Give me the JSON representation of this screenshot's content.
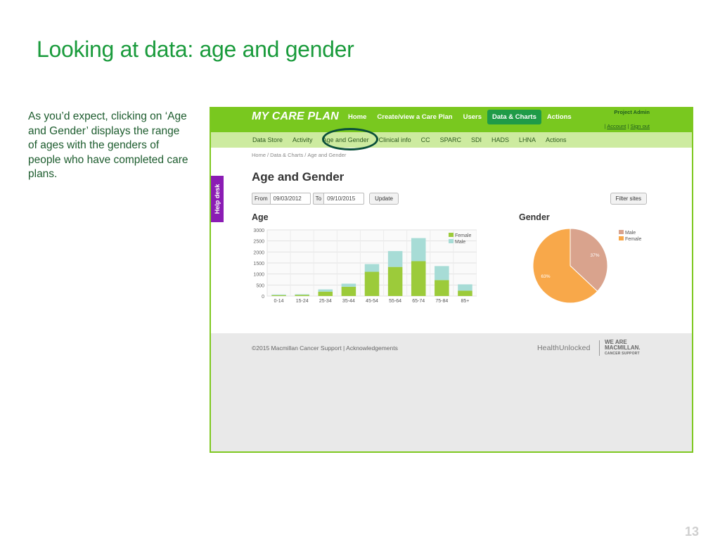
{
  "slide": {
    "title": "Looking at data: age and gender",
    "intro": "As you’d expect, clicking on ‘Age and Gender’ displays the range of ages with the genders of people who have completed care plans.",
    "page_number": "13"
  },
  "app": {
    "logo": "MY CARE PLAN",
    "nav": [
      "Home",
      "Create/view a Care Plan",
      "Users",
      "Data & Charts",
      "Actions"
    ],
    "nav_active": "Data & Charts",
    "user": {
      "name": "Project Admin",
      "account": "Account",
      "sign_out": "Sign out"
    },
    "subnav": [
      "Data Store",
      "Activity",
      "Age and Gender",
      "Clinical info",
      "CC",
      "SPARC",
      "SDI",
      "HADS",
      "LHNA",
      "Actions"
    ],
    "breadcrumb": [
      "Home",
      "Data & Charts",
      "Age and Gender"
    ],
    "help_desk": "Help desk",
    "heading": "Age and Gender",
    "filters": {
      "from_label": "From",
      "from_value": "09/03/2012",
      "to_label": "To",
      "to_value": "09/10/2015",
      "update_label": "Update",
      "filter_sites_label": "Filter sites"
    },
    "footer": {
      "copyright": "©2015 Macmillan Cancer Support | Acknowledgements",
      "healthunlocked": "HealthUnlocked",
      "macmillan_line1": "WE ARE",
      "macmillan_line2": "MACMILLAN.",
      "macmillan_line3": "CANCER SUPPORT"
    }
  },
  "colors": {
    "title_green": "#1a9b3c",
    "topbar_green": "#79c81f",
    "subbar_green": "#cdeba0",
    "female_bar": "#9ccb3a",
    "male_bar": "#a7dcd6",
    "pie_male": "#d9a38d",
    "pie_female": "#f8a84a",
    "help_desk": "#8b1cb4"
  },
  "chart_data": [
    {
      "type": "bar",
      "title": "Age",
      "stacked": true,
      "categories": [
        "0-14",
        "15-24",
        "25-34",
        "35-44",
        "45-54",
        "55-64",
        "65-74",
        "75-84",
        "85+"
      ],
      "series": [
        {
          "name": "Female",
          "values": [
            40,
            50,
            200,
            420,
            1100,
            1320,
            1580,
            720,
            240
          ]
        },
        {
          "name": "Male",
          "values": [
            30,
            30,
            100,
            140,
            350,
            720,
            1050,
            640,
            290
          ]
        }
      ],
      "yticks": [
        0,
        500,
        1000,
        1500,
        2000,
        2500,
        3000
      ],
      "ylim": [
        0,
        3000
      ],
      "grid": true,
      "legend": "top-right"
    },
    {
      "type": "pie",
      "title": "Gender",
      "labels": [
        "Male",
        "Female"
      ],
      "values": [
        37,
        63
      ],
      "value_labels": [
        "37%",
        "63%"
      ],
      "legend": "right"
    }
  ]
}
